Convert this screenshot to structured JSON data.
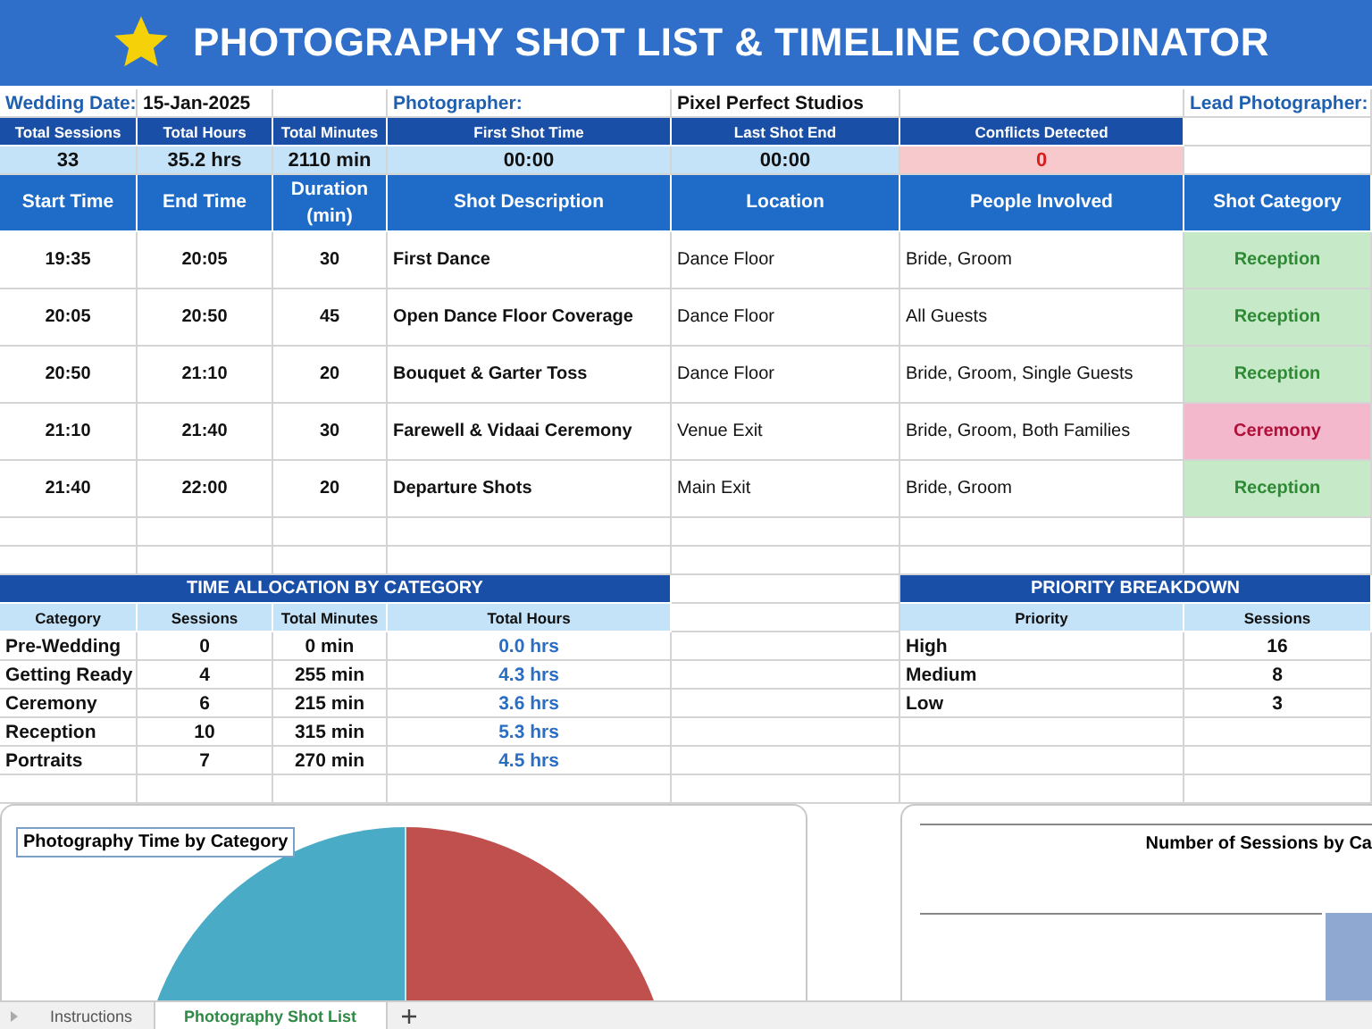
{
  "title": "PHOTOGRAPHY SHOT LIST & TIMELINE COORDINATOR",
  "info": {
    "wedding_date_label": "Wedding Date:",
    "wedding_date": "15-Jan-2025",
    "photographer_label": "Photographer:",
    "photographer": "Pixel Perfect Studios",
    "lead_photographer_label": "Lead Photographer:"
  },
  "summary": [
    {
      "label": "Total Sessions",
      "value": "33",
      "kind": "normal"
    },
    {
      "label": "Total Hours",
      "value": "35.2 hrs",
      "kind": "normal"
    },
    {
      "label": "Total Minutes",
      "value": "2110 min",
      "kind": "normal"
    },
    {
      "label": "First Shot Time",
      "value": "00:00",
      "kind": "normal"
    },
    {
      "label": "Last Shot End",
      "value": "00:00",
      "kind": "normal"
    },
    {
      "label": "Conflicts Detected",
      "value": "0",
      "kind": "alert"
    }
  ],
  "shots": {
    "columns": [
      "Start Time",
      "End Time",
      "Duration (min)",
      "Shot Description",
      "Location",
      "People Involved",
      "Shot Category"
    ],
    "rows": [
      {
        "start": "19:35",
        "end": "20:05",
        "duration": "30",
        "description": "First Dance",
        "location": "Dance Floor",
        "people": "Bride, Groom",
        "category": "Reception",
        "kind": "reception"
      },
      {
        "start": "20:05",
        "end": "20:50",
        "duration": "45",
        "description": "Open Dance Floor Coverage",
        "location": "Dance Floor",
        "people": "All Guests",
        "category": "Reception",
        "kind": "reception"
      },
      {
        "start": "20:50",
        "end": "21:10",
        "duration": "20",
        "description": "Bouquet & Garter Toss",
        "location": "Dance Floor",
        "people": "Bride, Groom, Single Guests",
        "category": "Reception",
        "kind": "reception"
      },
      {
        "start": "21:10",
        "end": "21:40",
        "duration": "30",
        "description": "Farewell & Vidaai Ceremony",
        "location": "Venue Exit",
        "people": "Bride, Groom, Both Families",
        "category": "Ceremony",
        "kind": "ceremony"
      },
      {
        "start": "21:40",
        "end": "22:00",
        "duration": "20",
        "description": "Departure Shots",
        "location": "Main Exit",
        "people": "Bride, Groom",
        "category": "Reception",
        "kind": "reception"
      }
    ]
  },
  "time_allocation": {
    "title": "TIME ALLOCATION BY CATEGORY",
    "columns": [
      "Category",
      "Sessions",
      "Total Minutes",
      "Total Hours"
    ],
    "rows": [
      {
        "category": "Pre-Wedding",
        "sessions": "0",
        "minutes": "0 min",
        "hours": "0.0 hrs"
      },
      {
        "category": "Getting Ready",
        "sessions": "4",
        "minutes": "255 min",
        "hours": "4.3 hrs"
      },
      {
        "category": "Ceremony",
        "sessions": "6",
        "minutes": "215 min",
        "hours": "3.6 hrs"
      },
      {
        "category": "Reception",
        "sessions": "10",
        "minutes": "315 min",
        "hours": "5.3 hrs"
      },
      {
        "category": "Portraits",
        "sessions": "7",
        "minutes": "270 min",
        "hours": "4.5 hrs"
      }
    ]
  },
  "priority": {
    "title": "PRIORITY BREAKDOWN",
    "columns": [
      "Priority",
      "Sessions"
    ],
    "rows": [
      {
        "priority": "High",
        "sessions": "16"
      },
      {
        "priority": "Medium",
        "sessions": "8"
      },
      {
        "priority": "Low",
        "sessions": "3"
      }
    ]
  },
  "charts": {
    "pie_title": "Photography Time by Category",
    "bar_title": "Number of Sessions by Ca"
  },
  "sheet_tabs": [
    {
      "label": "Instructions",
      "selected": false
    },
    {
      "label": "Photography Shot List",
      "selected": true
    }
  ]
}
